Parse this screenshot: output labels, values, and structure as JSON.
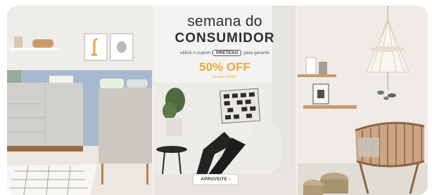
{
  "banner": {
    "headline_line1": "semana do",
    "headline_line2": "CONSUMIDOR",
    "coupon_prefix": "utilize o cupom",
    "coupon_code": "PRETESO",
    "coupon_suffix": "para garantir",
    "discount": "50% OFF",
    "discount_note": "no seu Uniqb*",
    "cta_label": "APROVEITE ›"
  },
  "colors": {
    "accent_orange": "#f0a73a",
    "headline_text": "#2d2d2d",
    "wall_blue": "#a7b9cf",
    "wood": "#c99a6a"
  },
  "panels": [
    {
      "name": "nursery-left",
      "description_icons": [
        "giraffe-frame-icon",
        "bear-frame-icon"
      ]
    },
    {
      "name": "campaign-center"
    },
    {
      "name": "nursery-right",
      "description_icons": [
        "cradle-icon",
        "mobile-icon"
      ]
    }
  ]
}
